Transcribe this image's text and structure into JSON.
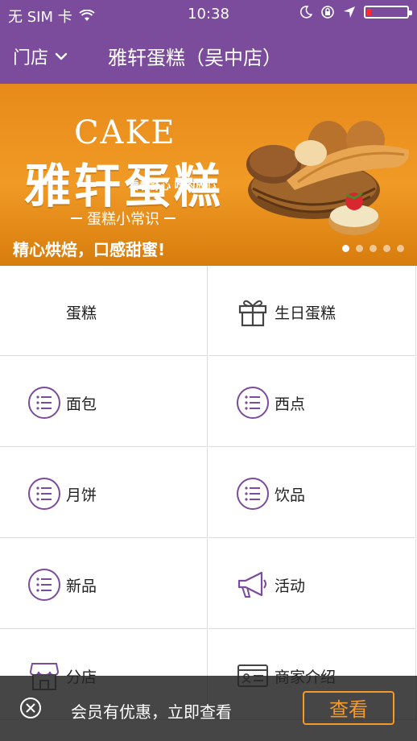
{
  "status_bar": {
    "carrier": "无 SIM 卡",
    "time": "10:38",
    "battery_level": 0.1
  },
  "navbar": {
    "store_label": "门店",
    "title": "雅轩蛋糕（吴中店）"
  },
  "banner": {
    "cake_en": "CAKE",
    "brand": "雅轩蛋糕",
    "slogan": "看着舒心 吃的放心",
    "knowledge": "蛋糕小常识",
    "caption": "精心烘焙，口感甜蜜!",
    "slide_count": 5,
    "active_slide": 1
  },
  "categories": [
    {
      "label": "蛋糕",
      "icon": "none"
    },
    {
      "label": "生日蛋糕",
      "icon": "gift-icon"
    },
    {
      "label": "面包",
      "icon": "list-icon"
    },
    {
      "label": "西点",
      "icon": "list-icon"
    },
    {
      "label": "月饼",
      "icon": "list-icon"
    },
    {
      "label": "饮品",
      "icon": "list-icon"
    },
    {
      "label": "新品",
      "icon": "list-icon"
    },
    {
      "label": "活动",
      "icon": "megaphone-icon"
    },
    {
      "label": "分店",
      "icon": "shop-icon"
    },
    {
      "label": "商家介绍",
      "icon": "id-card-icon"
    }
  ],
  "notice": {
    "message": "会员有优惠，立即查看",
    "button_label": "查看"
  },
  "colors": {
    "brand_purple": "#7a4c9b",
    "accent_orange": "#f39a2b"
  }
}
